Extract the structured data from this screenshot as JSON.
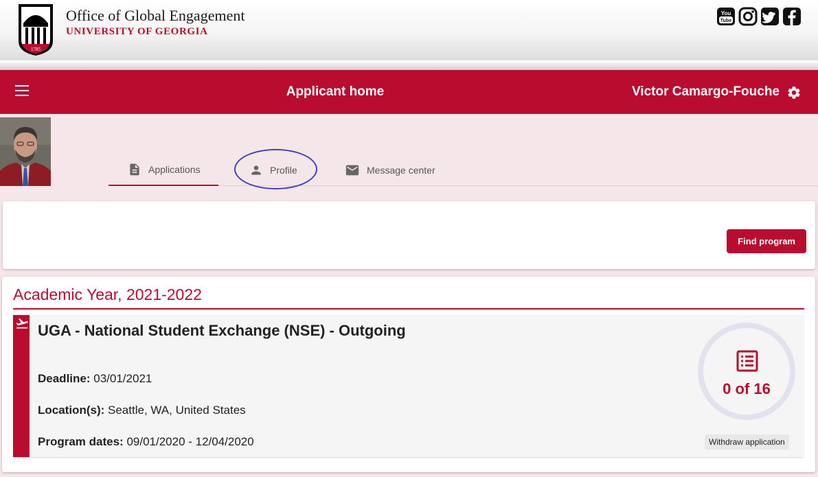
{
  "header": {
    "org_title": "Office of Global Engagement",
    "org_subtitle": "UNIVERSITY OF GEORGIA",
    "logo_year": "1785",
    "social_icons": [
      "youtube-icon",
      "instagram-icon",
      "twitter-icon",
      "facebook-icon"
    ],
    "youtube_you": "You",
    "youtube_tube": "Tube"
  },
  "topbar": {
    "title": "Applicant home",
    "user_name": "Victor Camargo-Fouche"
  },
  "tabs": [
    {
      "label": "Applications",
      "icon": "document-icon",
      "active": true
    },
    {
      "label": "Profile",
      "icon": "person-icon",
      "active": false
    },
    {
      "label": "Message center",
      "icon": "mail-icon",
      "active": false
    }
  ],
  "actions": {
    "find_program": "Find program"
  },
  "applications": {
    "year_title": "Academic Year, 2021-2022",
    "program": {
      "name": "UGA - National Student Exchange (NSE) - Outgoing",
      "deadline_label": "Deadline:",
      "deadline": "03/01/2021",
      "location_label": "Location(s):",
      "location": "Seattle, WA, United States",
      "dates_label": "Program dates:",
      "dates": "09/01/2020 - 12/04/2020",
      "progress_text": "0 of 16",
      "progress_completed": 0,
      "progress_total": 16,
      "withdraw_label": "Withdraw application"
    }
  },
  "colors": {
    "brand_red": "#ba0c2f",
    "page_bg": "#f5e6e9",
    "annotation_blue": "#3b3fc9"
  }
}
